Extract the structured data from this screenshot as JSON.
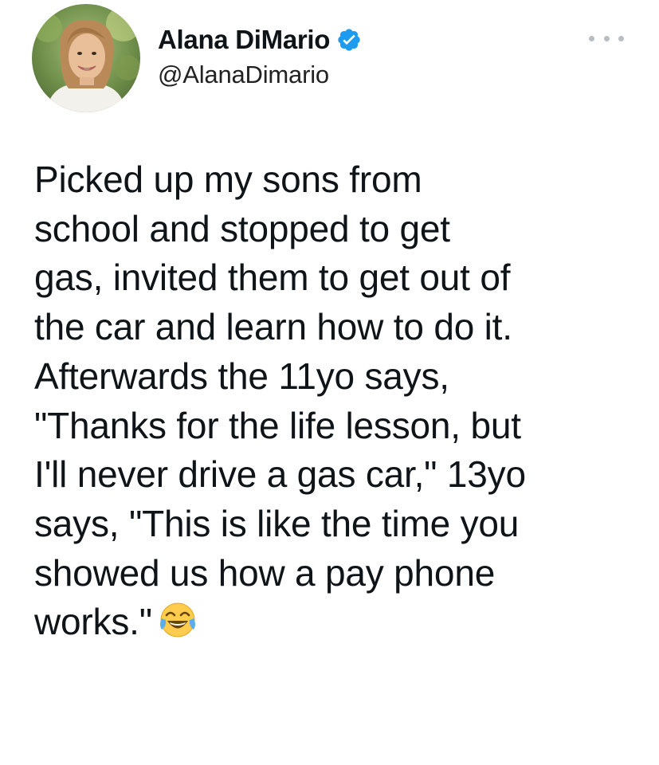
{
  "author": {
    "display_name": "Alana DiMario",
    "handle": "@AlanaDimario",
    "verified": true,
    "avatar_icon": "profile-photo",
    "verified_icon": "verified-badge-icon"
  },
  "tweet": {
    "text": "Picked up my sons from\nschool and stopped to get\ngas, invited them to get out of\nthe car and learn how to do it.\nAfterwards the 11yo says,\n\"Thanks for the life lesson, but\nI'll never drive a gas car,\" 13yo\nsays, \"This is like the time you\nshowed us how a pay phone\nworks.\"",
    "emoji": "face-with-tears-of-joy"
  },
  "menu": {
    "icon": "more-options-icon"
  },
  "colors": {
    "verified_blue": "#1d9bf0",
    "text": "#0f1419",
    "muted": "#b8bec4"
  }
}
